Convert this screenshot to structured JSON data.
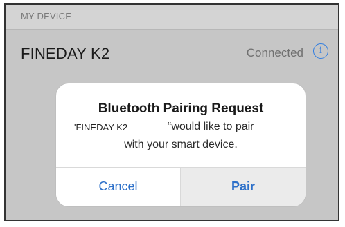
{
  "section": {
    "header_label": "MY DEVICE"
  },
  "device": {
    "name": "FINEDAY K2",
    "status": "Connected",
    "info_icon_glyph": "i",
    "info_icon": "info-circle-icon"
  },
  "dialog": {
    "title": "Bluetooth Pairing Request",
    "line1_name": "'FINEDAY K2",
    "line1_rest": "“would like to pair",
    "line2": "with your smart device.",
    "cancel_label": "Cancel",
    "pair_label": "Pair"
  },
  "colors": {
    "accent": "#2f7de1",
    "button_text": "#2b6fc9",
    "background": "#c6c6c6",
    "dialog_background": "#ffffff",
    "pair_button_background": "#ebebeb"
  }
}
